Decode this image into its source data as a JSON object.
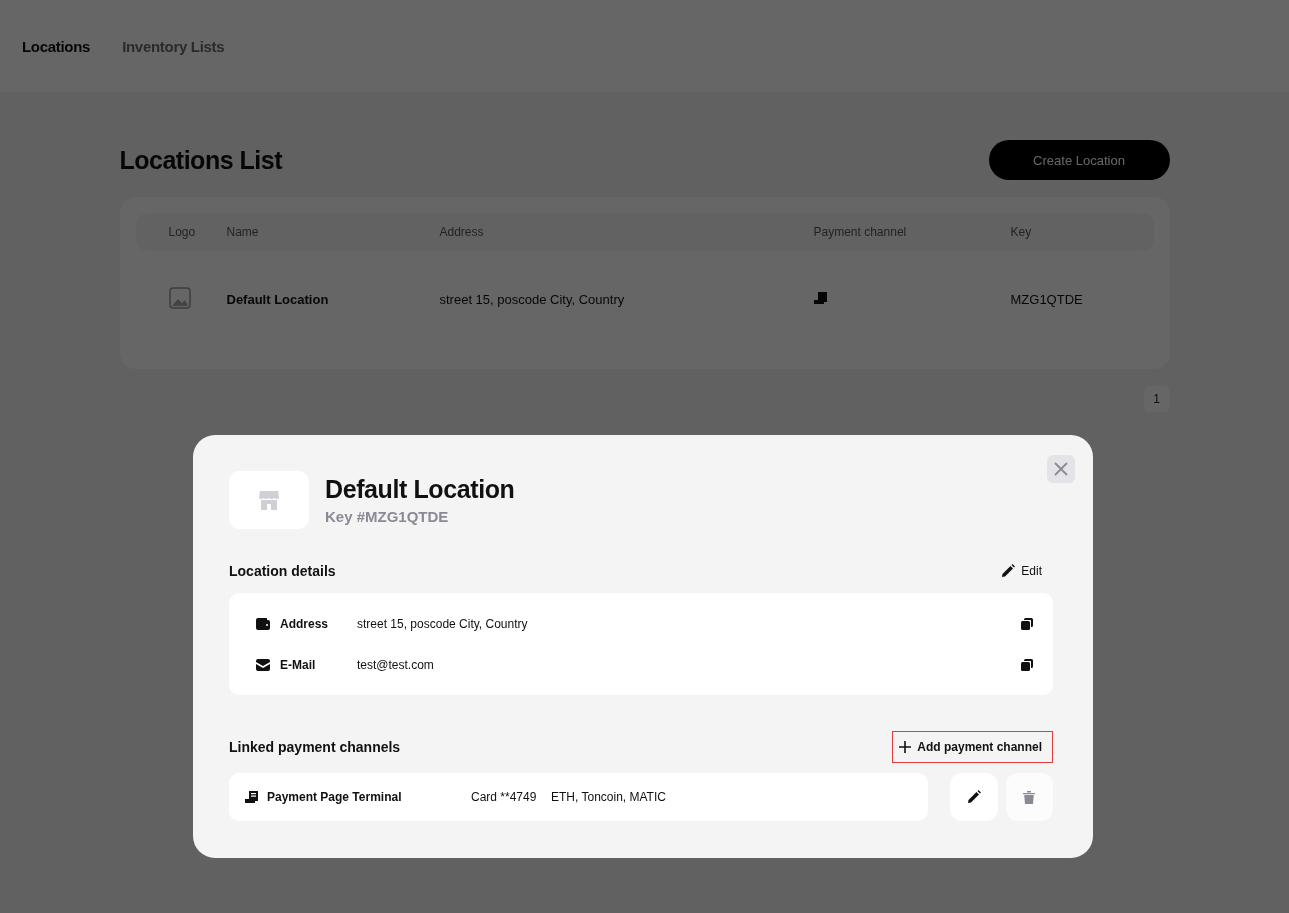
{
  "nav": {
    "tabs": [
      {
        "label": "Locations",
        "selected": true
      },
      {
        "label": "Inventory Lists",
        "selected": false
      }
    ]
  },
  "page": {
    "title": "Locations List",
    "create_button": "Create Location",
    "table": {
      "columns": [
        "Logo",
        "Name",
        "Address",
        "Payment channel",
        "Key"
      ],
      "rows": [
        {
          "name": "Default Location",
          "address": "street 15, poscode City, Country",
          "key": "MZG1QTDE"
        }
      ]
    },
    "pagination": [
      {
        "label": "1"
      }
    ]
  },
  "modal": {
    "title": "Default Location",
    "subtitle": "Key #MZG1QTDE",
    "details": {
      "heading": "Location details",
      "edit": "Edit",
      "rows": [
        {
          "kind": "address",
          "label": "Address",
          "value": "street 15, poscode City, Country"
        },
        {
          "kind": "email",
          "label": "E-Mail",
          "value": "test@test.com"
        }
      ]
    },
    "channels": {
      "heading": "Linked payment channels",
      "add": {
        "label": "Add payment channel",
        "focused": true
      },
      "items": [
        {
          "name": "Payment Page Terminal",
          "card": "Card **4749",
          "currencies": "ETH, Toncoin, MATIC",
          "delete_disabled": true
        }
      ]
    }
  }
}
